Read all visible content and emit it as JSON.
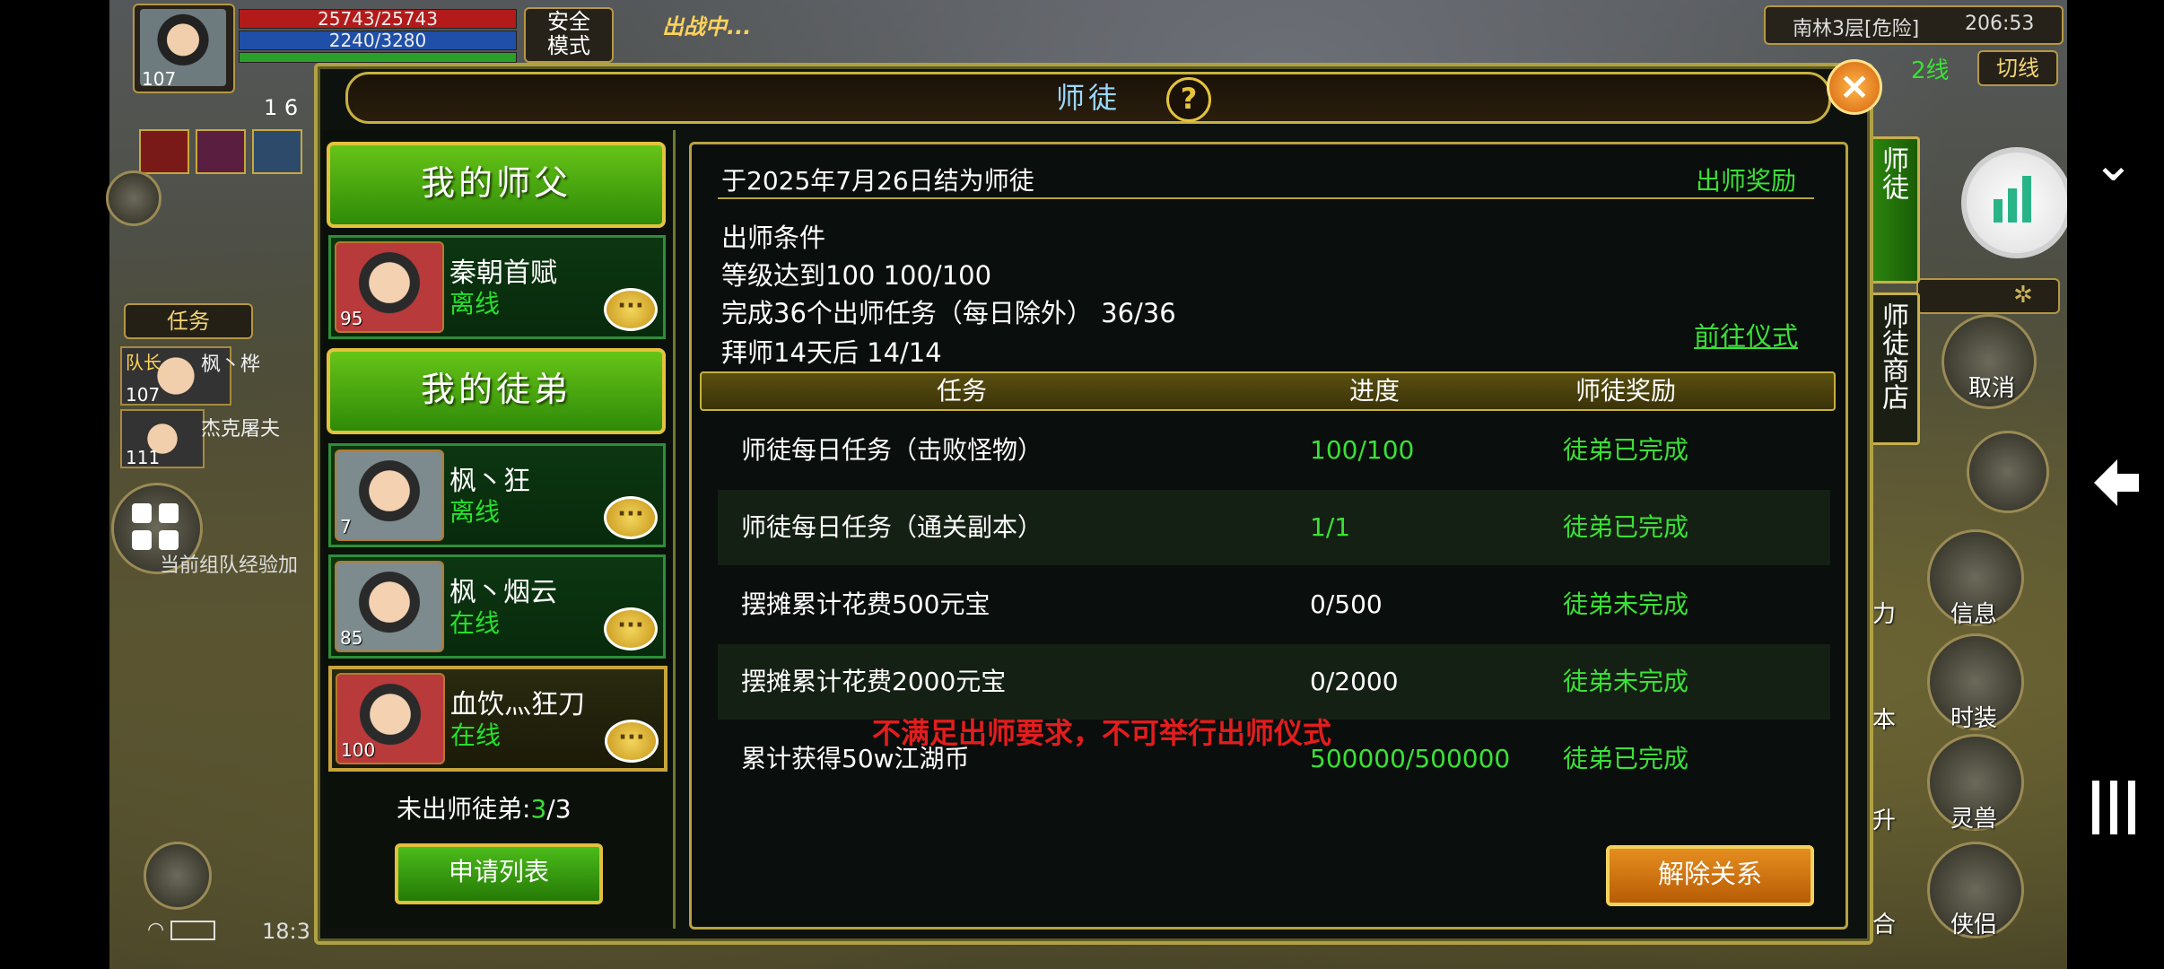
{
  "hud": {
    "player_level": "107",
    "hp": "25743/25743",
    "mp": "2240/3280",
    "safe_mode_label": "安全",
    "safe_mode_sub": "模式",
    "status_text": "出战中...",
    "gold_partial": "1 6",
    "location": "南林3层[危险]",
    "coords": "206:53",
    "line": "2线",
    "switch_line": "切线",
    "tab_task": "任务",
    "team_member_1": "枫丶桦",
    "team_member_1_level": "107",
    "team_member_2": "杰克屠夫",
    "team_member_2_level": "111",
    "team_leader_tag": "队长",
    "team_exp_text": "当前组队经验加",
    "time": "18:3",
    "cancel": "取消",
    "right_labels": [
      "信息",
      "时装",
      "灵兽",
      "侠侣"
    ],
    "right_partial": [
      "力",
      "本",
      "升",
      "合"
    ],
    "tab_master": "师徒",
    "tab_shop": "师徒商店"
  },
  "dialog": {
    "title": "师徒",
    "help": "?",
    "close": "×",
    "my_master_header": "我的师父",
    "my_apprentice_header": "我的徒弟",
    "master": {
      "name": "秦朝首赋",
      "status": "离线",
      "level": "95"
    },
    "apprentices": [
      {
        "name": "枫丶狂",
        "status": "离线",
        "level": "7",
        "status_color": "#26e02b"
      },
      {
        "name": "枫丶烟云",
        "status": "在线",
        "level": "85",
        "status_color": "#26e02b"
      },
      {
        "name": "血饮灬狂刀",
        "status": "在线",
        "level": "100",
        "status_color": "#26e02b"
      }
    ],
    "chat": "···",
    "unfinished_label": "未出师徒弟:",
    "unfinished_count": "3",
    "unfinished_total": "/3",
    "apply_list": "申请列表",
    "bond_date": "于2025年7月26日结为师徒",
    "graduate_reward": "出师奖励",
    "conditions_title": "出师条件",
    "condition_1": "等级达到100   100/100",
    "condition_2": "完成36个出师任务（每日除外）   36/36",
    "condition_3": "拜师14天后   14/14",
    "go_ceremony": "前往仪式",
    "table_headers": {
      "task": "任务",
      "progress": "进度",
      "reward": "师徒奖励"
    },
    "tasks": [
      {
        "task": "师徒每日任务（击败怪物）",
        "progress": "100/100",
        "progress_color": "#3be037",
        "reward": "徒弟已完成"
      },
      {
        "task": "师徒每日任务（通关副本）",
        "progress": "1/1",
        "progress_color": "#3be037",
        "reward": "徒弟已完成"
      },
      {
        "task": "摆摊累计花费500元宝",
        "progress": "0/500",
        "progress_color": "#ffffff",
        "reward": "徒弟未完成"
      },
      {
        "task": "摆摊累计花费2000元宝",
        "progress": "0/2000",
        "progress_color": "#ffffff",
        "reward": "徒弟未完成"
      },
      {
        "task": "累计获得50w江湖币",
        "progress": "500000/500000",
        "progress_color": "#3be037",
        "reward": "徒弟已完成"
      }
    ],
    "warning": "不满足出师要求，不可举行出师仪式",
    "dissolve": "解除关系"
  }
}
